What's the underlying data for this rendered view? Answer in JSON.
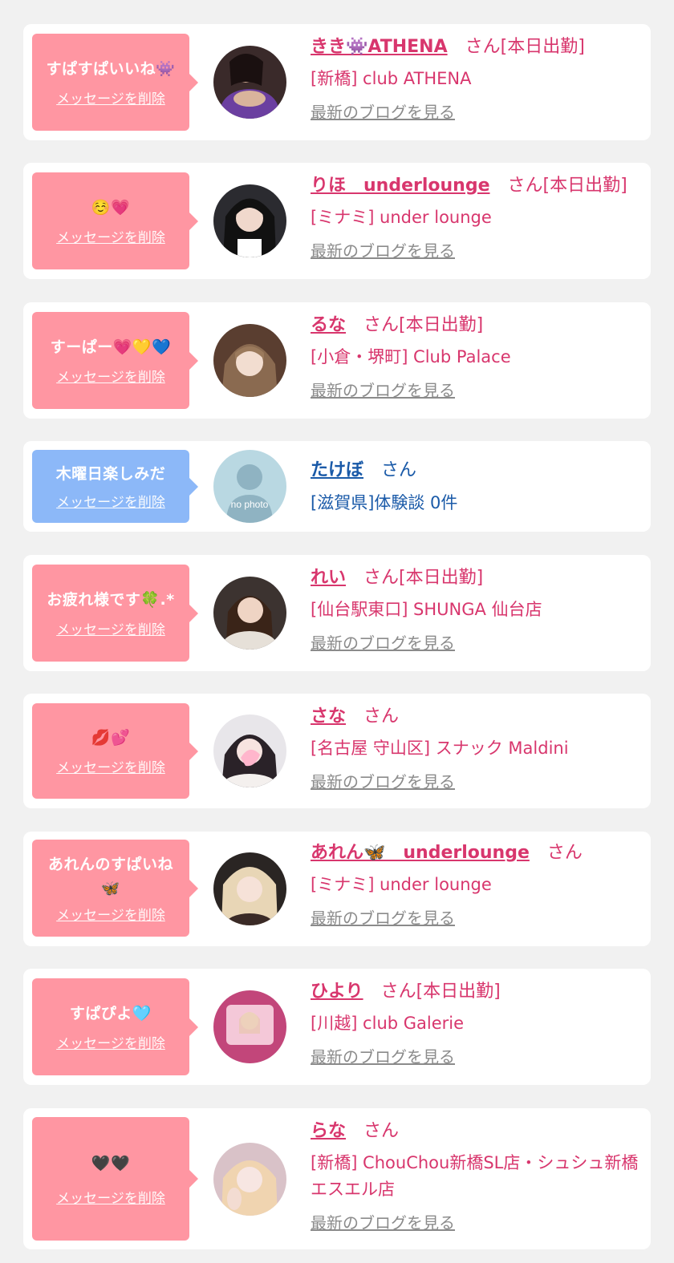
{
  "delete_label": "メッセージを削除",
  "blog_label": "最新のブログを見る",
  "san_label": "さん",
  "no_photo_label": "no photo",
  "colors": {
    "pink": "#ff96a2",
    "blue": "#8cb8f8",
    "name_pink": "#d8366d",
    "name_blue": "#1a5aa8"
  },
  "items": [
    {
      "message": "すぱすぱいいね👾",
      "name": "きき👾ATHENA",
      "status": "[本日出勤]",
      "shop": "[新橋] club ATHENA",
      "theme": "pink"
    },
    {
      "message": "☺️💗",
      "name": "りほ　underlounge",
      "status": "[本日出勤]",
      "shop": "[ミナミ] under lounge",
      "theme": "pink"
    },
    {
      "message": "すーぱー💗💛💙",
      "name": "るな",
      "status": "[本日出勤]",
      "shop": "[小倉・堺町] Club Palace",
      "theme": "pink"
    },
    {
      "message": "木曜日楽しみだ",
      "name": "たけぼ",
      "status": "",
      "shop": "[滋賀県]体験談 0件",
      "theme": "blue"
    },
    {
      "message": "お疲れ様です🍀.*",
      "name": "れい",
      "status": "[本日出勤]",
      "shop": "[仙台駅東口] SHUNGA 仙台店",
      "theme": "pink"
    },
    {
      "message": "💋💕",
      "name": "さな",
      "status": "",
      "shop": "[名古屋 守山区] スナック Maldini",
      "theme": "pink"
    },
    {
      "message": "あれんのすぱいね🦋",
      "name": "あれん🦋　underlounge",
      "status": "",
      "shop": "[ミナミ] under lounge",
      "theme": "pink"
    },
    {
      "message": "すぱぴよ🩵",
      "name": "ひより",
      "status": "[本日出勤]",
      "shop": "[川越] club Galerie",
      "theme": "pink"
    },
    {
      "message": "🖤🖤",
      "name": "らな",
      "status": "",
      "shop": "[新橋] ChouChou新橋SL店・シュシュ新橋エスエル店",
      "theme": "pink"
    }
  ]
}
